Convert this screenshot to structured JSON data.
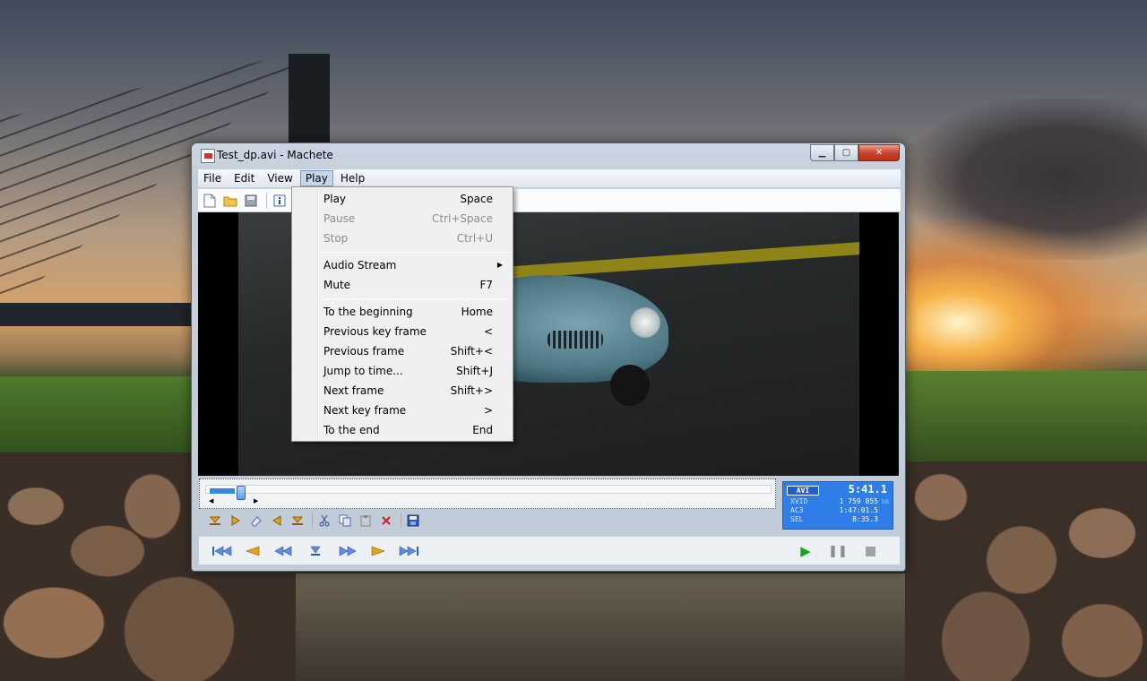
{
  "window": {
    "title": "Test_dp.avi - Machete",
    "caption": {
      "minimize": "▁",
      "maximize": "▢",
      "close": "✕"
    }
  },
  "menubar": {
    "items": [
      "File",
      "Edit",
      "View",
      "Play",
      "Help"
    ],
    "active": "Play"
  },
  "toolbar": {
    "icons": [
      "new-file-icon",
      "open-folder-icon",
      "save-icon",
      "info-icon"
    ]
  },
  "play_menu": {
    "items": [
      {
        "label": "Play",
        "shortcut": "Space",
        "enabled": true
      },
      {
        "label": "Pause",
        "shortcut": "Ctrl+Space",
        "enabled": false
      },
      {
        "label": "Stop",
        "shortcut": "Ctrl+U",
        "enabled": false
      },
      {
        "label": "Audio Stream",
        "shortcut": "",
        "submenu": true,
        "enabled": true
      },
      {
        "label": "Mute",
        "shortcut": "F7",
        "enabled": true
      },
      {
        "label": "To the beginning",
        "shortcut": "Home",
        "enabled": true
      },
      {
        "label": "Previous key frame",
        "shortcut": "<",
        "enabled": true
      },
      {
        "label": "Previous frame",
        "shortcut": "Shift+<",
        "enabled": true
      },
      {
        "label": "Jump to time...",
        "shortcut": "Shift+J",
        "enabled": true
      },
      {
        "label": "Next frame",
        "shortcut": "Shift+>",
        "enabled": true
      },
      {
        "label": "Next key frame",
        "shortcut": ">",
        "enabled": true
      },
      {
        "label": "To the end",
        "shortcut": "End",
        "enabled": true
      }
    ]
  },
  "seek": {
    "position_fraction": 0.05
  },
  "info": {
    "container": "AVI",
    "duration": "5:41.1",
    "video_codec": "XVID",
    "video_size": "1 759 855",
    "video_size_unit": "kB",
    "audio_codec": "AC3",
    "audio_time": "1:47:01.5",
    "sel_label": "SEL",
    "sel_value": "8:35.3"
  },
  "edit_toolbar": {
    "icons": [
      "mark-in-icon",
      "go-mark-in-icon",
      "eraser-icon",
      "go-mark-out-icon",
      "mark-out-icon",
      "cut-icon",
      "copy-icon",
      "paste-icon",
      "delete-icon",
      "save-icon"
    ]
  },
  "nav_toolbar": {
    "icons": [
      "to-beginning-icon",
      "previous-key-frame-icon",
      "previous-frame-icon",
      "jump-icon",
      "next-frame-icon",
      "next-key-frame-icon",
      "to-end-icon",
      "play-icon",
      "pause-icon",
      "stop-icon"
    ]
  },
  "colors": {
    "accent": "#2f7de6",
    "play_green": "#17a51a"
  }
}
